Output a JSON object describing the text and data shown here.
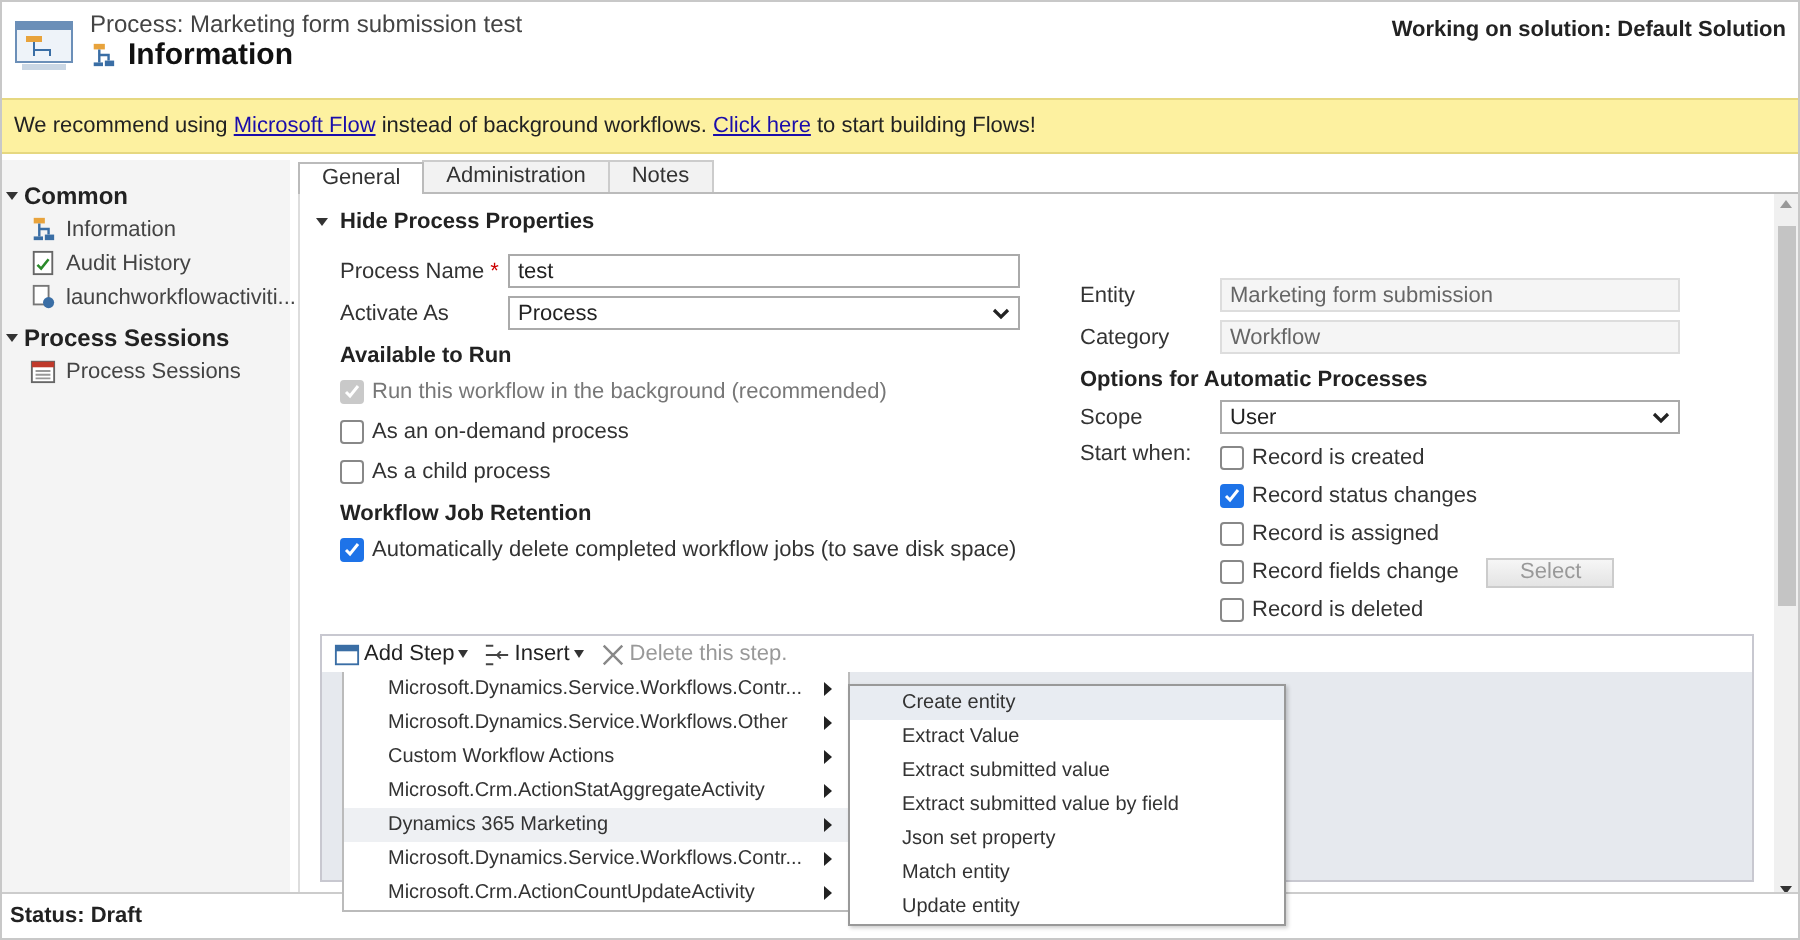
{
  "header": {
    "title": "Process: Marketing form submission test",
    "subtitle": "Information",
    "solution": "Working on solution: Default Solution"
  },
  "banner": [
    {
      "kind": "text",
      "text": "We recommend using "
    },
    {
      "kind": "link",
      "text": "Microsoft Flow"
    },
    {
      "kind": "text",
      "text": " instead of background workflows. "
    },
    {
      "kind": "link",
      "text": "Click here"
    },
    {
      "kind": "text",
      "text": " to start building Flows!"
    }
  ],
  "nav": [
    {
      "title": "Common",
      "expanded": true,
      "items": [
        {
          "label": "Information"
        },
        {
          "label": "Audit History"
        },
        {
          "label": "launchworkflowactiviti..."
        }
      ]
    },
    {
      "title": "Process Sessions",
      "expanded": true,
      "items": [
        {
          "label": "Process Sessions"
        }
      ]
    }
  ],
  "tabs": [
    {
      "label": "General",
      "selected": true
    },
    {
      "label": "Administration",
      "selected": false
    },
    {
      "label": "Notes",
      "selected": false
    }
  ],
  "properties": {
    "toggle": "Hide Process Properties",
    "expanded": true
  },
  "process_name": {
    "label": "Process Name",
    "required_mark": "*",
    "value": "test"
  },
  "activate_as": {
    "label": "Activate As",
    "value": "Process"
  },
  "available_to_run": {
    "heading": "Available to Run",
    "options": [
      {
        "label": "Run this workflow in the background (recommended)",
        "checked": true,
        "disabled": true
      },
      {
        "label": "As an on-demand process",
        "checked": false,
        "disabled": false
      },
      {
        "label": "As a child process",
        "checked": false,
        "disabled": false
      }
    ]
  },
  "retention": {
    "heading": "Workflow Job Retention",
    "options": [
      {
        "label": "Automatically delete completed workflow jobs (to save disk space)",
        "checked": true,
        "disabled": false
      }
    ]
  },
  "entity": {
    "label": "Entity",
    "value": "Marketing form submission"
  },
  "category": {
    "label": "Category",
    "value": "Workflow"
  },
  "automatic": {
    "heading": "Options for Automatic Processes"
  },
  "scope": {
    "label": "Scope",
    "value": "User"
  },
  "start_when": {
    "label": "Start when:",
    "options": [
      {
        "label": "Record is created",
        "checked": false
      },
      {
        "label": "Record status changes",
        "checked": true
      },
      {
        "label": "Record is assigned",
        "checked": false
      },
      {
        "label": "Record fields change",
        "checked": false,
        "button": {
          "label": "Select",
          "disabled": true
        }
      },
      {
        "label": "Record is deleted",
        "checked": false
      }
    ]
  },
  "toolbar": [
    {
      "kind": "add",
      "label": "Add Step",
      "disabled": false
    },
    {
      "kind": "insert",
      "label": "Insert",
      "disabled": false
    },
    {
      "kind": "delete",
      "label": "Delete this step.",
      "disabled": true
    }
  ],
  "menu": [
    {
      "label": "Microsoft.Dynamics.Service.Workflows.Contr...",
      "selected": false
    },
    {
      "label": "Microsoft.Dynamics.Service.Workflows.Other",
      "selected": false
    },
    {
      "label": "Custom Workflow Actions",
      "selected": false
    },
    {
      "label": "Microsoft.Crm.ActionStatAggregateActivity",
      "selected": false
    },
    {
      "label": "Dynamics 365 Marketing",
      "selected": true
    },
    {
      "label": "Microsoft.Dynamics.Service.Workflows.Contr...",
      "selected": false
    },
    {
      "label": "Microsoft.Crm.ActionCountUpdateActivity",
      "selected": false
    }
  ],
  "submenu": [
    {
      "label": "Create entity",
      "selected": true
    },
    {
      "label": "Extract Value",
      "selected": false
    },
    {
      "label": "Extract submitted value",
      "selected": false
    },
    {
      "label": "Extract submitted value by field",
      "selected": false
    },
    {
      "label": "Json set property",
      "selected": false
    },
    {
      "label": "Match entity",
      "selected": false
    },
    {
      "label": "Update entity",
      "selected": false
    }
  ],
  "status": "Status: Draft"
}
